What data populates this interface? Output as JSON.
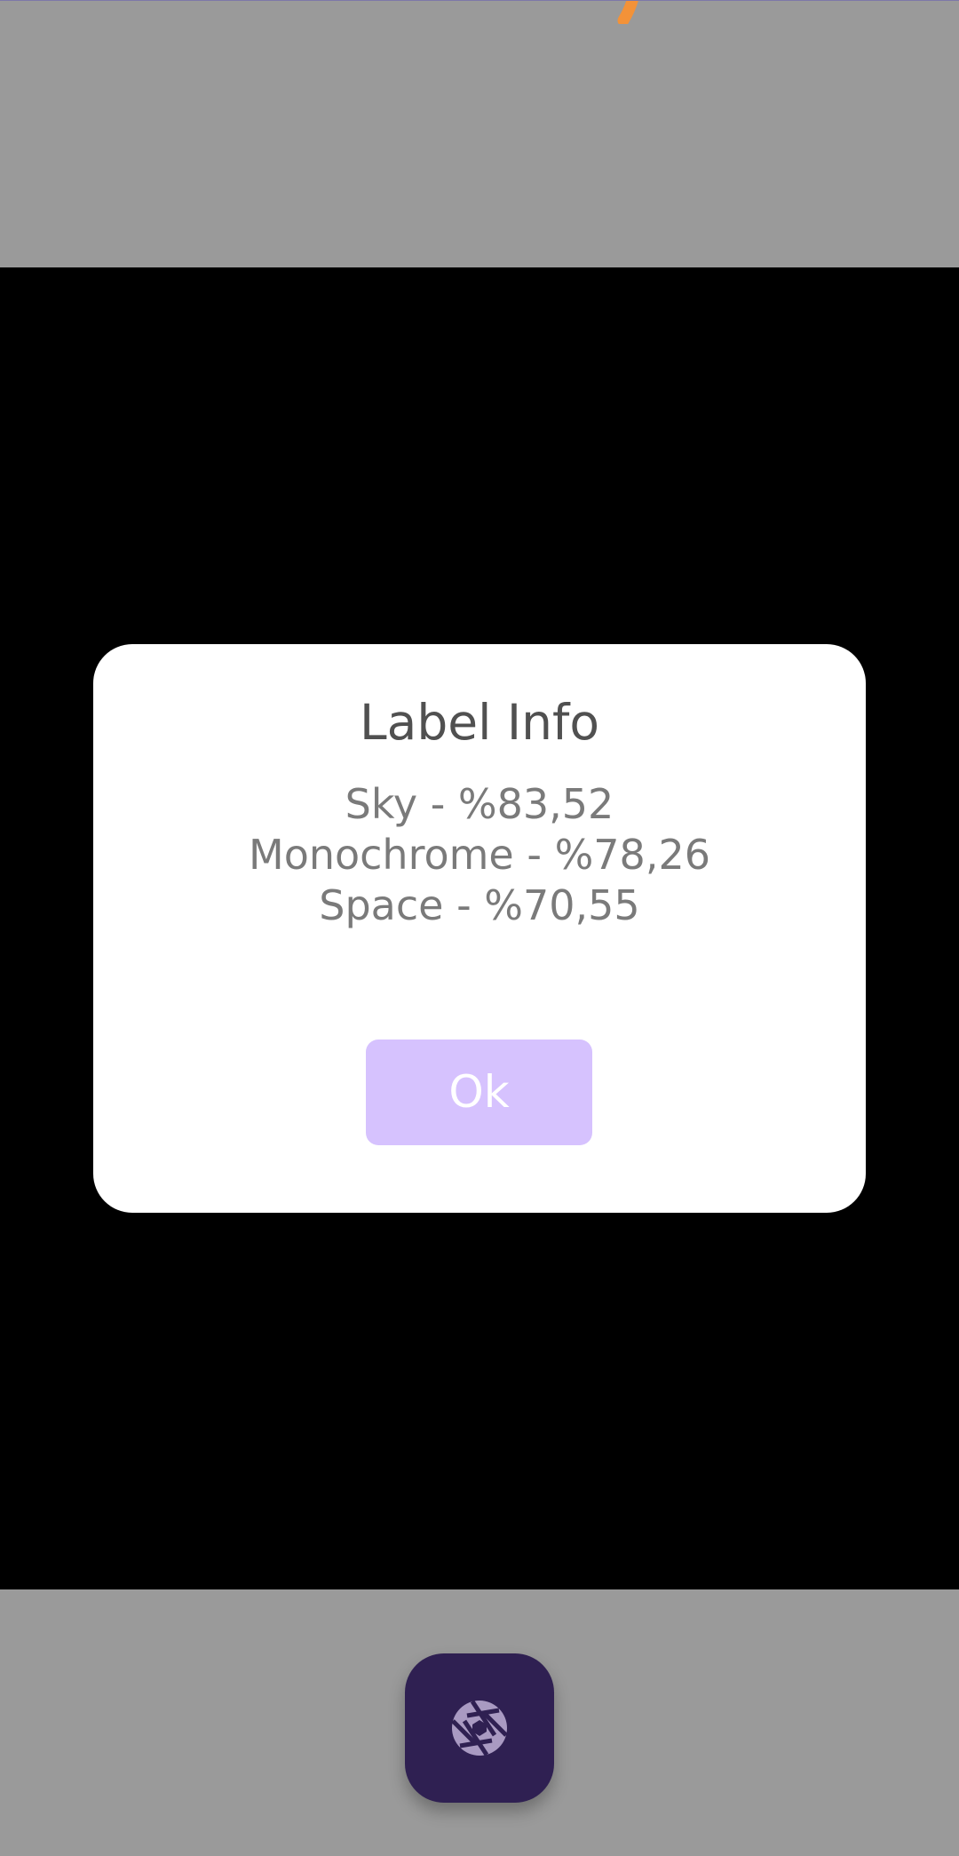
{
  "dialog": {
    "title": "Label Info",
    "labels": [
      "Sky - %83,52",
      "Monochrome - %78,26",
      "Space - %70,55"
    ],
    "ok_label": "Ok"
  },
  "capture": {
    "icon": "camera-shutter-icon"
  },
  "colors": {
    "screen_background": "#9a9a9a",
    "preview_background": "#000000",
    "dialog_background": "#ffffff",
    "ok_button": "#d6c2fe",
    "capture_button": "#2f2052",
    "accent_orange": "#f39238"
  }
}
